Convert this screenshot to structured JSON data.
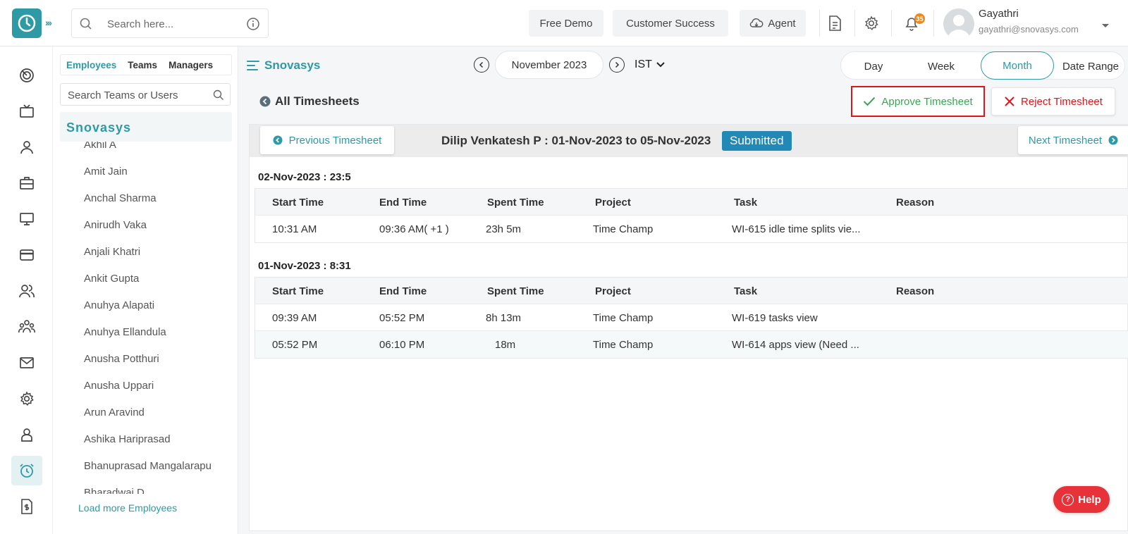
{
  "header": {
    "search_placeholder": "Search here...",
    "free_demo": "Free Demo",
    "customer_success": "Customer Success",
    "agent": "Agent",
    "notification_count": "35",
    "user_name": "Gayathri",
    "user_email": "gayathri@snovasys.com"
  },
  "panel": {
    "tabs": [
      "Employees",
      "Teams",
      "Managers"
    ],
    "active_tab": "Employees",
    "search_placeholder": "Search Teams or Users",
    "org_name": "Snovasys",
    "employees": [
      "Akhil A",
      "Amit Jain",
      "Anchal Sharma",
      "Anirudh Vaka",
      "Anjali Khatri",
      "Ankit Gupta",
      "Anuhya Alapati",
      "Anuhya Ellandula",
      "Anusha Potthuri",
      "Anusha Uppari",
      "Arun Aravind",
      "Ashika Hariprasad",
      "Bhanuprasad Mangalarapu",
      "Bharadwaj D"
    ],
    "load_more": "Load more Employees"
  },
  "toolbar": {
    "brand": "Snovasys",
    "month": "November 2023",
    "timezone": "IST",
    "ranges": [
      "Day",
      "Week",
      "Month",
      "Date Range"
    ],
    "active_range": "Month",
    "back_label": "All Timesheets",
    "approve_label": "Approve Timesheet",
    "reject_label": "Reject Timesheet"
  },
  "timesheet": {
    "prev_label": "Previous Timesheet",
    "next_label": "Next Timesheet",
    "title": "Dilip Venkatesh P : 01-Nov-2023 to 05-Nov-2023",
    "status": "Submitted",
    "columns": [
      "Start Time",
      "End Time",
      "Spent Time",
      "Project",
      "Task",
      "Reason"
    ],
    "days": [
      {
        "heading": "02-Nov-2023 : 23:5",
        "rows": [
          [
            "10:31 AM",
            "09:36 AM( +1 )",
            "23h 5m",
            "Time Champ",
            "WI-615 idle time splits vie...",
            ""
          ]
        ]
      },
      {
        "heading": "01-Nov-2023 : 8:31",
        "rows": [
          [
            "09:39 AM",
            "05:52 PM",
            "8h 13m",
            "Time Champ",
            "WI-619 tasks view",
            ""
          ],
          [
            "05:52 PM",
            "06:10 PM",
            "18m",
            "Time Champ",
            "WI-614 apps view (Need ...",
            ""
          ]
        ]
      }
    ]
  },
  "help_label": "Help",
  "colors": {
    "accent": "#2d9aa6",
    "approve": "#3aa655",
    "reject": "#e0151c",
    "status": "#2288b5",
    "help": "#e8323a"
  },
  "icons": [
    "search-icon",
    "info-icon",
    "cloud-icon",
    "document-icon",
    "gear-icon",
    "bell-icon",
    "user-avatar",
    "chevron-down-icon",
    "dashboard-icon",
    "tv-icon",
    "person-icon",
    "briefcase-icon",
    "monitor-icon",
    "card-icon",
    "users-icon",
    "team-icon",
    "mail-icon",
    "settings-icon",
    "employee-icon",
    "alarm-clock-icon",
    "invoice-icon",
    "menu-icon",
    "check-icon",
    "close-icon"
  ]
}
